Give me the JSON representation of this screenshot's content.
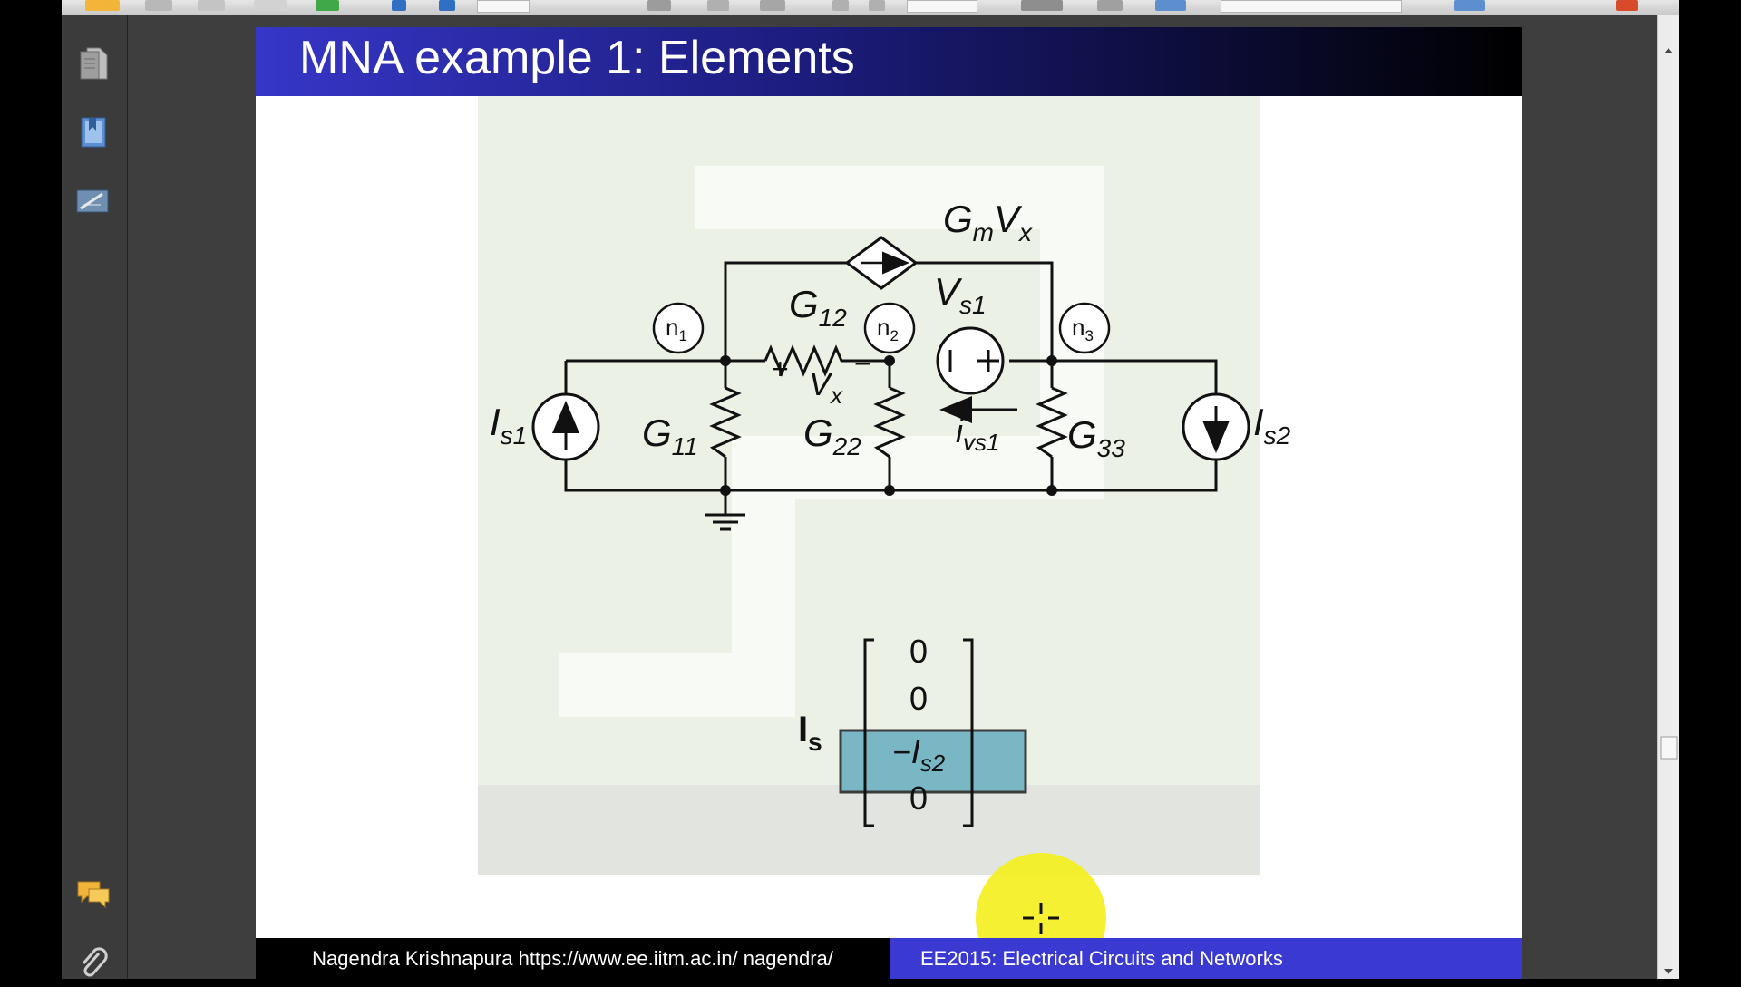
{
  "slide": {
    "title": "MNA example 1: Elements",
    "footer_left": "Nagendra Krishnapura  https://www.ee.iitm.ac.in/ nagendra/",
    "footer_right": "EE2015: Electrical Circuits and Networks"
  },
  "circuit": {
    "labels": {
      "gm": "G",
      "gm_sub": "m",
      "gm_v": "V",
      "gm_vsub": "x",
      "vs": "V",
      "vs_sub": "s1",
      "g12": "G",
      "g12_sub": "12",
      "g11": "G",
      "g11_sub": "11",
      "g22": "G",
      "g22_sub": "22",
      "g33": "G",
      "g33_sub": "33",
      "vx": "V",
      "vx_sub": "x",
      "ivs": "i",
      "ivs_sub": "vs1",
      "is1": "I",
      "is1_sub": "s1",
      "is2": "I",
      "is2_sub": "s2",
      "n1": "n",
      "n1_sub": "1",
      "n2": "n",
      "n2_sub": "2",
      "n3": "n",
      "n3_sub": "3",
      "plus": "+",
      "minus": "−"
    }
  },
  "vector": {
    "name": "I",
    "name_sub": "s",
    "entries": [
      "0",
      "0",
      "−I",
      "0"
    ],
    "entry3_sub": "s2",
    "highlight_color": "#78b7c3"
  },
  "icons": {
    "sidebar": [
      "pages-icon",
      "bookmarks-icon",
      "signature-icon",
      "comments-icon",
      "attachment-icon"
    ]
  },
  "colors": {
    "title_bar_start": "#3636c8",
    "footer_right_bg": "#3a3ad2",
    "cursor_highlight": "#f4ef1c"
  }
}
